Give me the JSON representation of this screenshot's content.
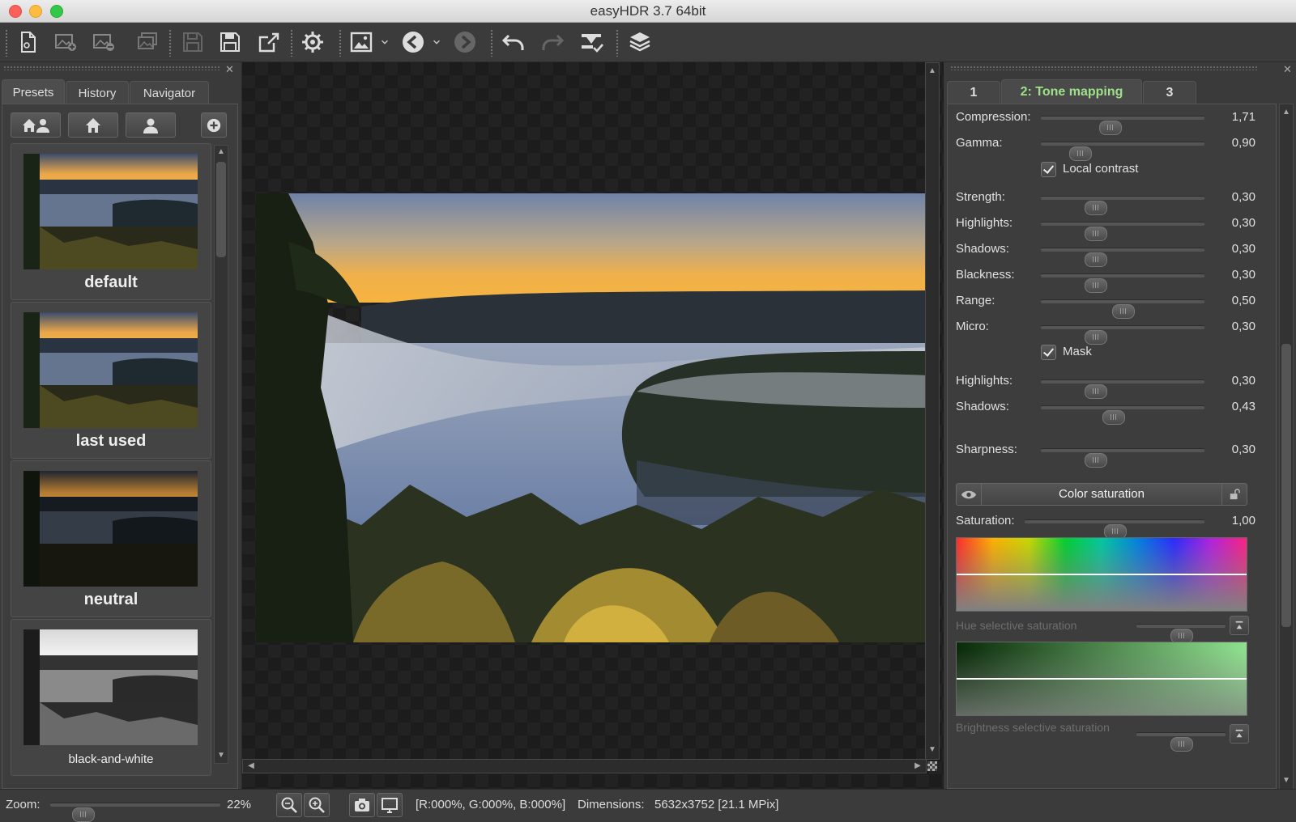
{
  "window": {
    "title": "easyHDR 3.7 64bit"
  },
  "toolbar": {
    "icons": [
      "new-document-icon",
      "add-image-icon",
      "remove-image-icon",
      "batch-icon",
      "save-disabled-icon",
      "save-icon",
      "export-icon",
      "settings-icon",
      "image-view-icon",
      "back-icon",
      "forward-icon",
      "undo-icon",
      "redo-icon",
      "clear-history-icon",
      "layers-icon"
    ]
  },
  "left_panel": {
    "tabs": [
      {
        "label": "Presets",
        "active": true
      },
      {
        "label": "History",
        "active": false
      },
      {
        "label": "Navigator",
        "active": false
      }
    ],
    "filter_buttons": [
      "all-presets-icon",
      "home-presets-icon",
      "user-presets-icon"
    ],
    "presets": [
      {
        "label": "default",
        "style": "color"
      },
      {
        "label": "last used",
        "style": "color"
      },
      {
        "label": "neutral",
        "style": "dark"
      },
      {
        "label": "black-and-white",
        "style": "bw"
      }
    ]
  },
  "right_panel": {
    "tabs": [
      {
        "label": "1",
        "active": false
      },
      {
        "label": "2: Tone mapping",
        "active": true
      },
      {
        "label": "3",
        "active": false
      }
    ],
    "sliders": [
      {
        "label": "Compression:",
        "value": "1,71",
        "position": 0.42
      },
      {
        "label": "Gamma:",
        "value": "0,90",
        "position": 0.24
      },
      {
        "label": "Strength:",
        "value": "0,30",
        "position": 0.33
      },
      {
        "label": "Highlights:",
        "value": "0,30",
        "position": 0.33
      },
      {
        "label": "Shadows:",
        "value": "0,30",
        "position": 0.33
      },
      {
        "label": "Blackness:",
        "value": "0,30",
        "position": 0.33
      },
      {
        "label": "Range:",
        "value": "0,50",
        "position": 0.5
      },
      {
        "label": "Micro:",
        "value": "0,30",
        "position": 0.33
      },
      {
        "label": "Highlights:",
        "value": "0,30",
        "position": 0.33
      },
      {
        "label": "Shadows:",
        "value": "0,43",
        "position": 0.44
      },
      {
        "label": "Sharpness:",
        "value": "0,30",
        "position": 0.33
      }
    ],
    "checkboxes": {
      "local_contrast": {
        "label": "Local contrast",
        "checked": true
      },
      "mask": {
        "label": "Mask",
        "checked": true
      }
    },
    "color_saturation": {
      "header": "Color saturation",
      "saturation_label": "Saturation:",
      "saturation_value": "1,00",
      "saturation_position": 0.5,
      "hue_label": "Hue selective saturation",
      "hue_position": 0.5,
      "brightness_label": "Brightness selective saturation",
      "brightness_position": 0.5
    }
  },
  "status": {
    "zoom_label": "Zoom:",
    "zoom_value": "22%",
    "zoom_position": 0.19,
    "rgb": "[R:000%, G:000%, B:000%]",
    "dimensions_label": "Dimensions:",
    "dimensions_value": "5632x3752 [21.1 MPix]"
  },
  "colors": {
    "accent_tab": "#9fe08a",
    "panel_bg": "#3a3a3a",
    "canvas_bg": "#1c1c1c"
  }
}
